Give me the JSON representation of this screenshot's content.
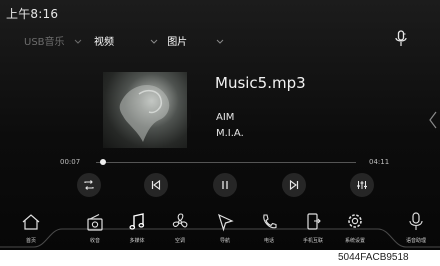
{
  "status": {
    "clock": "上午8:16"
  },
  "source_bar": {
    "items": [
      {
        "label": "USB音乐",
        "active": false
      },
      {
        "label": "视频",
        "active": true
      },
      {
        "label": "图片",
        "active": true
      }
    ],
    "mic_icon": "microphone-icon"
  },
  "track": {
    "title": "Music5.mp3",
    "artist": "AIM",
    "album": "M.I.A."
  },
  "progress": {
    "elapsed": "00:07",
    "total": "04:11",
    "fraction": 0.028
  },
  "controls": [
    {
      "name": "repeat-button",
      "icon": "repeat-icon"
    },
    {
      "name": "previous-button",
      "icon": "skip-previous-icon"
    },
    {
      "name": "pause-button",
      "icon": "pause-icon"
    },
    {
      "name": "next-button",
      "icon": "skip-next-icon"
    },
    {
      "name": "equalizer-button",
      "icon": "equalizer-icon"
    }
  ],
  "dock": [
    {
      "label": "首页",
      "icon": "home-icon"
    },
    {
      "label": "收音",
      "icon": "radio-icon"
    },
    {
      "label": "多媒体",
      "icon": "music-note-icon"
    },
    {
      "label": "空调",
      "icon": "fan-icon"
    },
    {
      "label": "导航",
      "icon": "navigation-icon"
    },
    {
      "label": "电话",
      "icon": "phone-icon"
    },
    {
      "label": "手机互联",
      "icon": "phone-link-icon"
    },
    {
      "label": "系统设置",
      "icon": "settings-icon"
    },
    {
      "label": "语音助理",
      "icon": "voice-assistant-icon"
    }
  ],
  "caption": "5044FACB9518",
  "colors": {
    "background": "#0c0c0c",
    "active_text": "#ffffff",
    "dim_text": "#6c6c6c"
  }
}
